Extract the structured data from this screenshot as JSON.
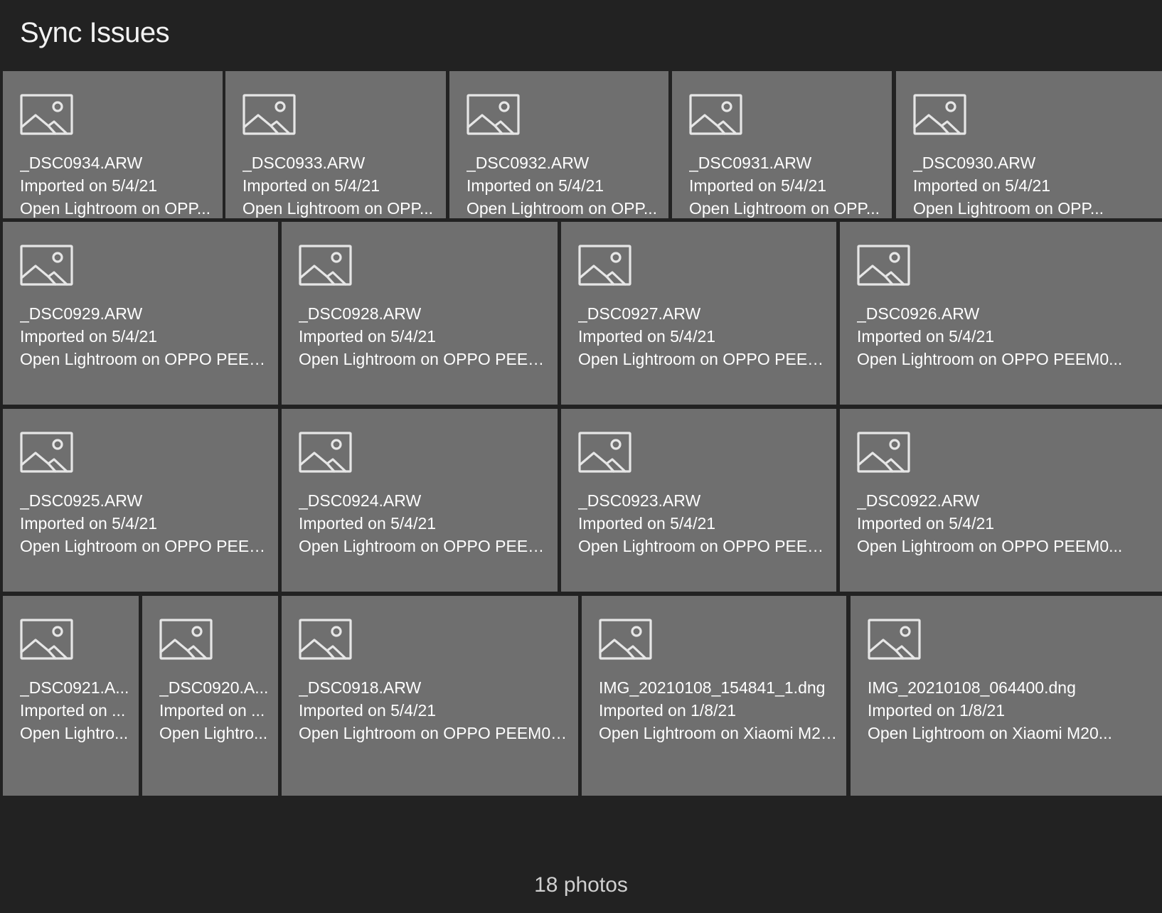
{
  "header": {
    "title": "Sync Issues"
  },
  "tiles": [
    {
      "filename": "_DSC0934.ARW",
      "imported": "Imported on 5/4/21",
      "status": "Open Lightroom on OPP..."
    },
    {
      "filename": "_DSC0933.ARW",
      "imported": "Imported on 5/4/21",
      "status": "Open Lightroom on OPP..."
    },
    {
      "filename": "_DSC0932.ARW",
      "imported": "Imported on 5/4/21",
      "status": "Open Lightroom on OPP..."
    },
    {
      "filename": "_DSC0931.ARW",
      "imported": "Imported on 5/4/21",
      "status": "Open Lightroom on OPP..."
    },
    {
      "filename": "_DSC0930.ARW",
      "imported": "Imported on 5/4/21",
      "status": "Open Lightroom on OPP..."
    },
    {
      "filename": "_DSC0929.ARW",
      "imported": "Imported on 5/4/21",
      "status": "Open Lightroom on OPPO PEEM0..."
    },
    {
      "filename": "_DSC0928.ARW",
      "imported": "Imported on 5/4/21",
      "status": "Open Lightroom on OPPO PEEM0..."
    },
    {
      "filename": "_DSC0927.ARW",
      "imported": "Imported on 5/4/21",
      "status": "Open Lightroom on OPPO PEEM0..."
    },
    {
      "filename": "_DSC0926.ARW",
      "imported": "Imported on 5/4/21",
      "status": "Open Lightroom on OPPO PEEM0..."
    },
    {
      "filename": "_DSC0925.ARW",
      "imported": "Imported on 5/4/21",
      "status": "Open Lightroom on OPPO PEEM0..."
    },
    {
      "filename": "_DSC0924.ARW",
      "imported": "Imported on 5/4/21",
      "status": "Open Lightroom on OPPO PEEM0..."
    },
    {
      "filename": "_DSC0923.ARW",
      "imported": "Imported on 5/4/21",
      "status": "Open Lightroom on OPPO PEEM0..."
    },
    {
      "filename": "_DSC0922.ARW",
      "imported": "Imported on 5/4/21",
      "status": "Open Lightroom on OPPO PEEM0..."
    },
    {
      "filename": "_DSC0921.A...",
      "imported": "Imported on ...",
      "status": "Open Lightro..."
    },
    {
      "filename": "_DSC0920.A...",
      "imported": "Imported on ...",
      "status": "Open Lightro..."
    },
    {
      "filename": "_DSC0918.ARW",
      "imported": "Imported on 5/4/21",
      "status": "Open Lightroom on OPPO PEEM00 t..."
    },
    {
      "filename": "IMG_20210108_154841_1.dng",
      "imported": "Imported on 1/8/21",
      "status": "Open Lightroom on Xiaomi M20..."
    },
    {
      "filename": "IMG_20210108_064400.dng",
      "imported": "Imported on 1/8/21",
      "status": "Open Lightroom on Xiaomi M20..."
    }
  ],
  "footer": {
    "count": "18 photos"
  },
  "icons": {
    "tile_placeholder": "image-placeholder-icon"
  },
  "colors": {
    "background": "#222222",
    "tile": "#6f6f6f",
    "icon_stroke": "#e6e6e6"
  }
}
